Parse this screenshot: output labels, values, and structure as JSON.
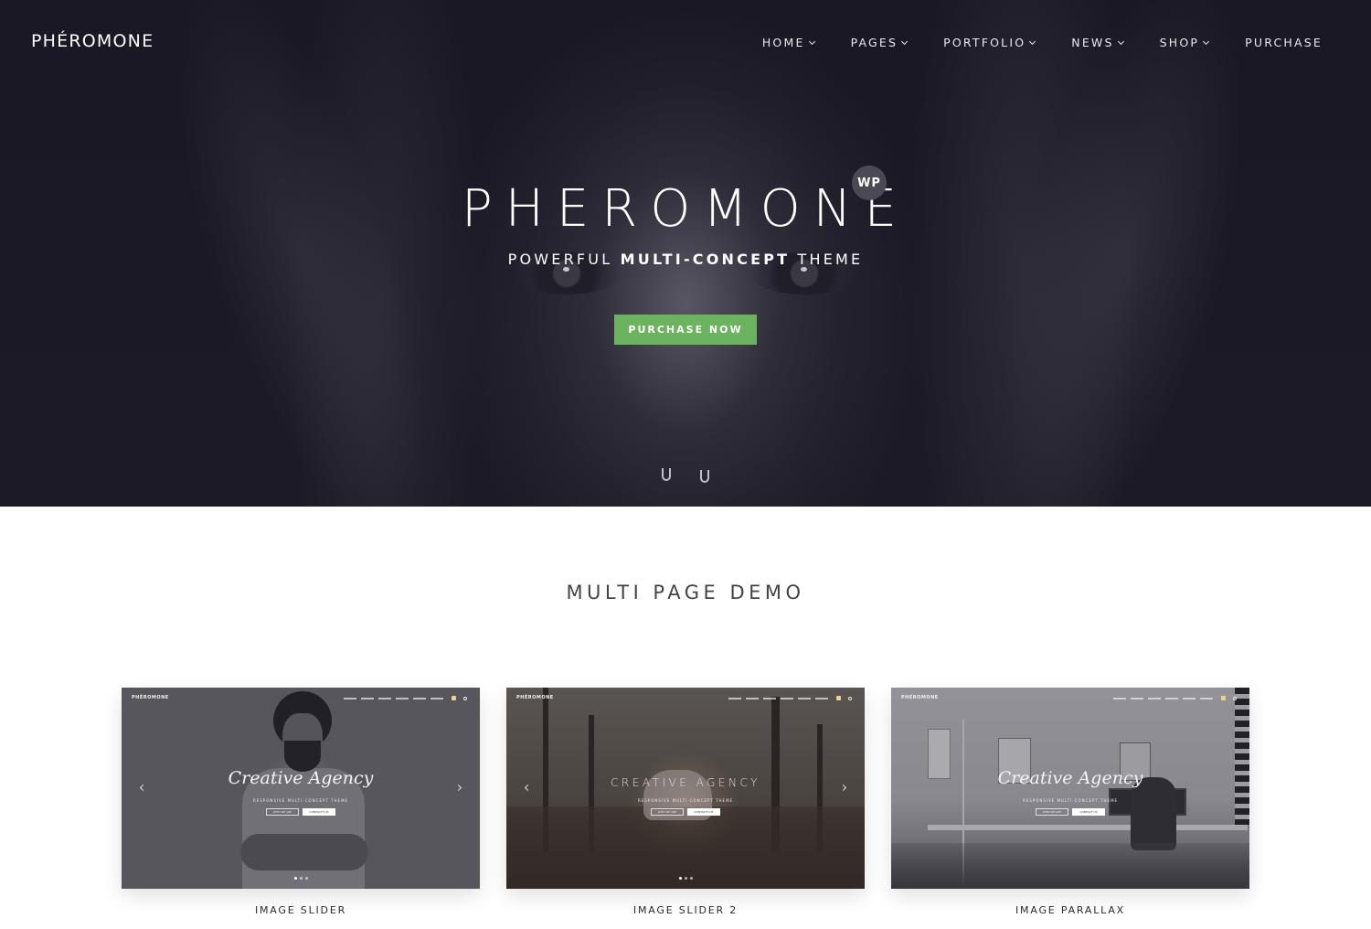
{
  "header": {
    "logo": "PHÉROMONE",
    "nav": [
      {
        "label": "HOME",
        "has_dropdown": true
      },
      {
        "label": "PAGES",
        "has_dropdown": true
      },
      {
        "label": "PORTFOLIO",
        "has_dropdown": true
      },
      {
        "label": "NEWS",
        "has_dropdown": true
      },
      {
        "label": "SHOP",
        "has_dropdown": true
      },
      {
        "label": "PURCHASE",
        "has_dropdown": false
      }
    ]
  },
  "hero": {
    "title": "PHEROMONE",
    "badge": "WP",
    "subtitle_pre": "POWERFUL ",
    "subtitle_bold": "MULTI-CONCEPT",
    "subtitle_post": " THEME",
    "cta_label": "PURCHASE NOW",
    "colors": {
      "background": "#1a1824",
      "cta": "#6bb35e",
      "badge": "#4a4954"
    }
  },
  "section": {
    "title": "MULTI PAGE DEMO"
  },
  "demos": [
    {
      "label": "IMAGE SLIDER",
      "preview": {
        "logo": "PHÉROMONE",
        "headline": "Creative Agency",
        "tagline": "RESPONSIVE MULTI-CONCEPT THEME",
        "button_outline": "WHO WE ARE",
        "button_solid": "CONTACTS US",
        "slides": 3,
        "active_slide": 1
      }
    },
    {
      "label": "IMAGE SLIDER 2",
      "preview": {
        "logo": "PHÉROMONE",
        "headline": "CREATIVE AGENCY",
        "tagline": "RESPONSIVE MULTI-CONCEPT THEME",
        "button_outline": "WHO WE ARE",
        "button_solid": "CONTACTS US",
        "slides": 3,
        "active_slide": 1
      }
    },
    {
      "label": "IMAGE PARALLAX",
      "preview": {
        "logo": "PHÉROMONE",
        "headline": "Creative Agency",
        "tagline": "RESPONSIVE MULTI-CONCEPT THEME",
        "button_outline": "WHO WE ARE",
        "button_solid": "CONTACT US"
      }
    }
  ]
}
